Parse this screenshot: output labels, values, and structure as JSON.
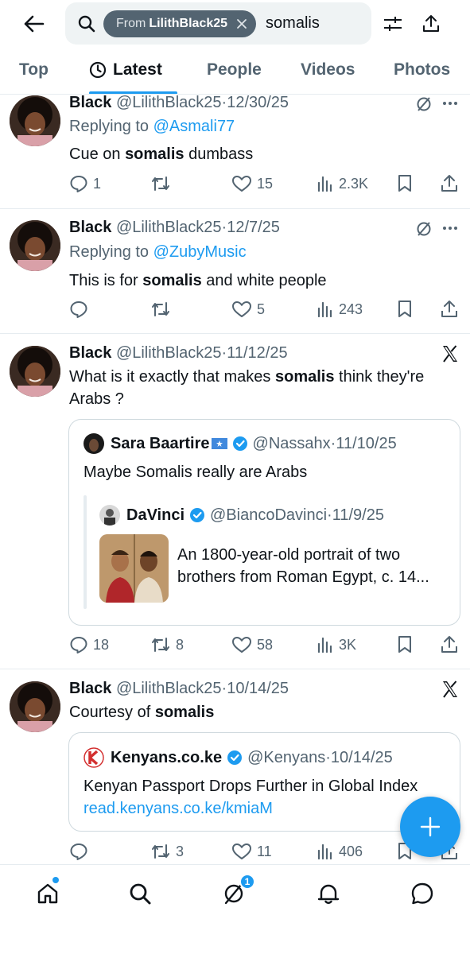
{
  "search": {
    "chip_prefix": "From",
    "chip_user": "LilithBlack25",
    "query": "somalis"
  },
  "tabs": [
    {
      "label": "Top"
    },
    {
      "label": "Latest"
    },
    {
      "label": "People"
    },
    {
      "label": "Videos"
    },
    {
      "label": "Photos"
    }
  ],
  "posts": [
    {
      "name": "Black",
      "handle": "@LilithBlack25",
      "date": "12/30/25",
      "reply_prefix": "Replying to",
      "reply_to": "@Asmali77",
      "text_before": "Cue on ",
      "text_bold": "somalis",
      "text_after": " dumbass",
      "replies": "1",
      "reposts": "",
      "likes": "15",
      "views": "2.3K"
    },
    {
      "name": "Black",
      "handle": "@LilithBlack25",
      "date": "12/7/25",
      "reply_prefix": "Replying to",
      "reply_to": "@ZubyMusic",
      "text_before": "This is for ",
      "text_bold": "somalis",
      "text_after": " and white people",
      "replies": "",
      "reposts": "",
      "likes": "5",
      "views": "243"
    },
    {
      "name": "Black",
      "handle": "@LilithBlack25",
      "date": "11/12/25",
      "text_before": "What is it exactly that makes ",
      "text_bold": "somalis",
      "text_after": " think they're Arabs ?",
      "quote": {
        "name": "Sara Baartire",
        "handle": "@Nassahx",
        "date": "11/10/25",
        "text": "Maybe Somalis really are Arabs",
        "nested": {
          "name": "DaVinci",
          "handle": "@BiancoDavinci",
          "date": "11/9/25",
          "text": "An 1800-year-old portrait of two brothers from Roman Egypt, c. 14..."
        }
      },
      "replies": "18",
      "reposts": "8",
      "likes": "58",
      "views": "3K"
    },
    {
      "name": "Black",
      "handle": "@LilithBlack25",
      "date": "10/14/25",
      "text_before": "Courtesy of ",
      "text_bold": "somalis",
      "text_after": "",
      "quote": {
        "name": "Kenyans.co.ke",
        "handle": "@Kenyans",
        "date": "10/14/25",
        "text": "Kenyan Passport Drops Further in Global Index",
        "link": "read.kenyans.co.ke/kmiaM"
      },
      "replies": "",
      "reposts": "3",
      "likes": "11",
      "views": "406"
    }
  ],
  "bottom_nav": {
    "grok_badge": "1"
  },
  "colors": {
    "accent": "#1d9bf0",
    "text": "#0f1419",
    "secondary": "#536471"
  },
  "icons": [
    "back-arrow-icon",
    "search-icon",
    "close-icon",
    "filter-icon",
    "share-icon",
    "clock-icon",
    "muted-icon",
    "more-icon",
    "x-logo-icon",
    "reply-icon",
    "repost-icon",
    "like-icon",
    "views-icon",
    "bookmark-icon",
    "verified-icon",
    "plus-icon",
    "home-icon",
    "grok-icon",
    "bell-icon",
    "chat-icon"
  ]
}
